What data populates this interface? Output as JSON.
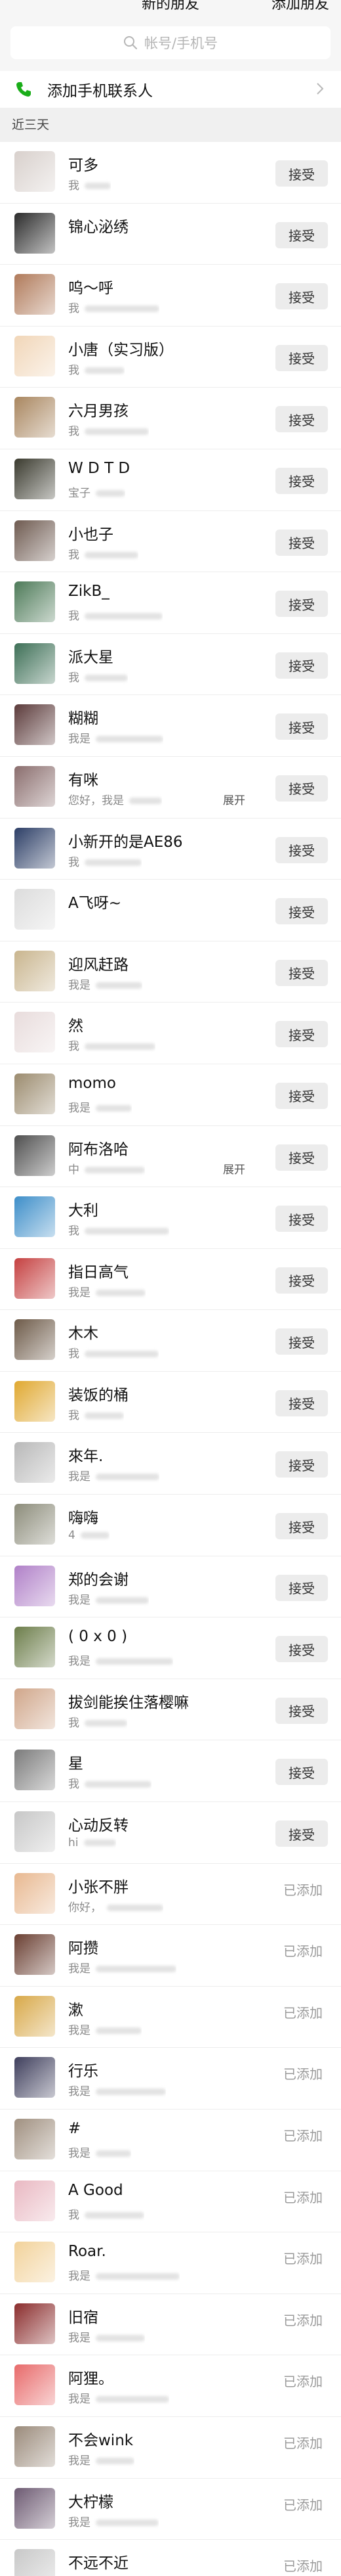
{
  "header": {
    "title": "新的朋友",
    "action": "添加朋友"
  },
  "search": {
    "placeholder": "帐号/手机号"
  },
  "add_contact": {
    "label": "添加手机联系人"
  },
  "section": {
    "label": "近三天"
  },
  "accept_label": "接受",
  "added_label": "已添加",
  "expand_label": "展开",
  "friends": [
    {
      "name": "可多",
      "msg": "我",
      "status": "accept",
      "color": "#d8d0cc"
    },
    {
      "name": "锦心泌绣",
      "msg": "",
      "status": "accept",
      "color": "#2b2b2b"
    },
    {
      "name": "呜～呼",
      "msg": "我",
      "status": "accept",
      "color": "#b07a5a"
    },
    {
      "name": "小唐（实习版）",
      "msg": "我",
      "status": "accept",
      "color": "#f1d6b8"
    },
    {
      "name": "六月男孩",
      "msg": "我",
      "status": "accept",
      "color": "#a9865f"
    },
    {
      "name": "W   D      T   D",
      "msg": "宝子",
      "status": "accept",
      "color": "#3a3a2e"
    },
    {
      "name": "小也子",
      "msg": "我",
      "status": "accept",
      "color": "#6e5a50"
    },
    {
      "name": "ZikB_",
      "msg": "我",
      "status": "accept",
      "color": "#4d7a58"
    },
    {
      "name": "派大星",
      "msg": "我",
      "status": "accept",
      "color": "#3d6f56"
    },
    {
      "name": "糊糊",
      "msg": "我是",
      "status": "accept",
      "color": "#5b3a3a"
    },
    {
      "name": "有咪",
      "msg": "您好，我是",
      "status": "accept",
      "color": "#8a6d6d",
      "expand": true
    },
    {
      "name": "小新开的是AE86",
      "msg": "我",
      "status": "accept",
      "color": "#2c3e66"
    },
    {
      "name": "A飞呀~",
      "msg": "",
      "status": "accept",
      "color": "#dcdcdc"
    },
    {
      "name": "迎风赶路",
      "msg": "我是",
      "status": "accept",
      "color": "#c9b58e"
    },
    {
      "name": "然",
      "msg": "我",
      "status": "accept",
      "color": "#e8dcdc"
    },
    {
      "name": "momo",
      "msg": "我是",
      "status": "accept",
      "color": "#9b8b6e"
    },
    {
      "name": "阿布洛哈",
      "msg": "中",
      "status": "accept",
      "color": "#4f4f4f",
      "expand": true
    },
    {
      "name": "大利",
      "msg": "我",
      "status": "accept",
      "color": "#3d8ec9"
    },
    {
      "name": "指日高气",
      "msg": "我是",
      "status": "accept",
      "color": "#c54040"
    },
    {
      "name": "木木",
      "msg": "我",
      "status": "accept",
      "color": "#6d5a48"
    },
    {
      "name": "装饭的桶",
      "msg": "我",
      "status": "accept",
      "color": "#e0a830"
    },
    {
      "name": "來年.",
      "msg": "我是",
      "status": "accept",
      "color": "#b8b8b8"
    },
    {
      "name": "嗨嗨",
      "msg": "4",
      "status": "accept",
      "color": "#8c8c7a"
    },
    {
      "name": "郑的会谢",
      "msg": "我是",
      "status": "accept",
      "color": "#b080c8"
    },
    {
      "name": "( 0 x 0 )",
      "msg": "我是",
      "status": "accept",
      "color": "#6c7d4a"
    },
    {
      "name": "拔剑能挨住落樱嘛",
      "msg": "我",
      "status": "accept",
      "color": "#d0a68a"
    },
    {
      "name": "星",
      "msg": "我",
      "status": "accept",
      "color": "#7b7b7b"
    },
    {
      "name": "心动反转",
      "msg": "hi",
      "status": "accept",
      "color": "#c7c7c7"
    },
    {
      "name": "小张不胖",
      "msg": "你好，",
      "status": "added",
      "color": "#e8b890"
    },
    {
      "name": "阿攒",
      "msg": "我是",
      "status": "added",
      "color": "#6a3f32"
    },
    {
      "name": "漱",
      "msg": "我是",
      "status": "added",
      "color": "#d8a848"
    },
    {
      "name": "行乐",
      "msg": "我是",
      "status": "added",
      "color": "#3e3e5c"
    },
    {
      "name": "#",
      "msg": "我是",
      "status": "added",
      "color": "#a09080"
    },
    {
      "name": "A Good",
      "msg": "我",
      "status": "added",
      "color": "#e9b8c2"
    },
    {
      "name": "Roar.",
      "msg": "我是",
      "status": "added",
      "color": "#f2d29a"
    },
    {
      "name": "旧宿",
      "msg": "我是",
      "status": "added",
      "color": "#8a2c2c"
    },
    {
      "name": "阿狸。",
      "msg": "我是",
      "status": "added",
      "color": "#e86a6a"
    },
    {
      "name": "不会wink",
      "msg": "我是",
      "status": "added",
      "color": "#9a8a7a"
    },
    {
      "name": "大柠檬",
      "msg": "我是",
      "status": "added",
      "color": "#6d5a72"
    },
    {
      "name": "不远不近",
      "msg": "",
      "status": "added",
      "color": "#c8c8c8"
    }
  ]
}
